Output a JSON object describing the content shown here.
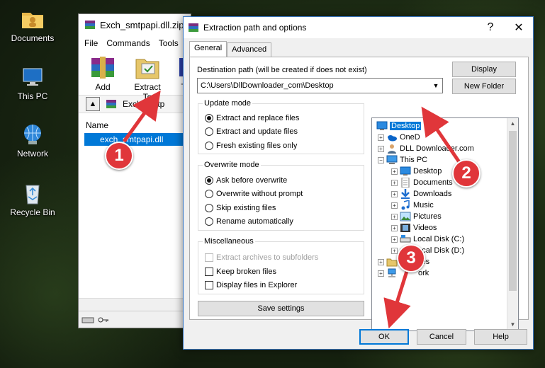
{
  "desktop": {
    "icons": [
      {
        "label": "Documents",
        "icon": "folder-icon"
      },
      {
        "label": "This PC",
        "icon": "computer-icon"
      },
      {
        "label": "Network",
        "icon": "network-icon"
      },
      {
        "label": "Recycle Bin",
        "icon": "recycle-bin-icon"
      }
    ]
  },
  "winrar": {
    "title": "Exch_smtpapi.dll.zip",
    "menu": [
      "File",
      "Commands",
      "Tools"
    ],
    "toolbar": [
      {
        "label": "Add",
        "icon": "add-archive-icon"
      },
      {
        "label": "Extract To",
        "icon": "extract-to-icon"
      },
      {
        "label": "T",
        "icon": "test-icon"
      }
    ],
    "path": "Exch_smtp",
    "column_name": "Name",
    "file": "exch_smtpapi.dll"
  },
  "dialog": {
    "title": "Extraction path and options",
    "help": "?",
    "close": "✕",
    "tabs": [
      "General",
      "Advanced"
    ],
    "dest_label": "Destination path (will be created if does not exist)",
    "dest_value": "C:\\Users\\DllDownloader_com\\Desktop",
    "display_btn": "Display",
    "new_folder_btn": "New Folder",
    "update_mode": {
      "title": "Update mode",
      "options": [
        "Extract and replace files",
        "Extract and update files",
        "Fresh existing files only"
      ],
      "selected": 0
    },
    "overwrite_mode": {
      "title": "Overwrite mode",
      "options": [
        "Ask before overwrite",
        "Overwrite without prompt",
        "Skip existing files",
        "Rename automatically"
      ],
      "selected": 0
    },
    "misc": {
      "title": "Miscellaneous",
      "options": [
        "Extract archives to subfolders",
        "Keep broken files",
        "Display files in Explorer"
      ]
    },
    "save_settings": "Save settings",
    "tree": [
      {
        "label": "Desktop",
        "icon": "desktop-icon"
      },
      {
        "label": "OneD",
        "icon": "onedrive-icon"
      },
      {
        "label": "DLL Downloader.com",
        "icon": "user-icon"
      },
      {
        "label": "This PC",
        "icon": "computer-icon"
      },
      {
        "label": "Desktop",
        "icon": "desktop-icon"
      },
      {
        "label": "Documents",
        "icon": "documents-icon"
      },
      {
        "label": "Downloads",
        "icon": "downloads-icon"
      },
      {
        "label": "Music",
        "icon": "music-icon"
      },
      {
        "label": "Pictures",
        "icon": "pictures-icon"
      },
      {
        "label": "Videos",
        "icon": "videos-icon"
      },
      {
        "label": "Local Disk (C:)",
        "icon": "drive-icon"
      },
      {
        "label": "Local Disk (D:)",
        "icon": "drive-icon"
      },
      {
        "label": "Libraries",
        "icon": "libraries-icon"
      },
      {
        "label": "ork",
        "icon": "network-icon"
      }
    ],
    "ok": "OK",
    "cancel": "Cancel",
    "help_btn": "Help"
  },
  "annotations": [
    "1",
    "2",
    "3"
  ],
  "colors": {
    "arrow": "#e0363a",
    "selection": "#0078d7"
  }
}
